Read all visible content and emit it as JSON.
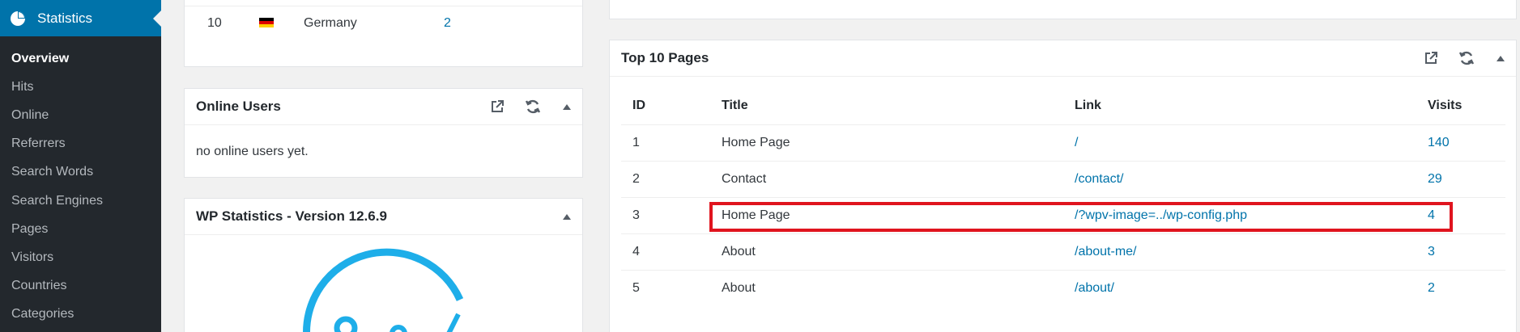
{
  "sidebar": {
    "header_title": "Statistics",
    "header_icon": "pie-chart-icon",
    "items": [
      {
        "label": "Overview",
        "current": true
      },
      {
        "label": "Hits"
      },
      {
        "label": "Online"
      },
      {
        "label": "Referrers"
      },
      {
        "label": "Search Words"
      },
      {
        "label": "Search Engines"
      },
      {
        "label": "Pages"
      },
      {
        "label": "Visitors"
      },
      {
        "label": "Countries"
      },
      {
        "label": "Categories"
      }
    ]
  },
  "countries": {
    "row": {
      "rank": "10",
      "flag_icon": "germany-flag-icon",
      "name": "Germany",
      "count": "2"
    }
  },
  "online_users": {
    "title": "Online Users",
    "empty_text": "no online users yet."
  },
  "version_panel": {
    "title": "WP Statistics - Version 12.6.9",
    "logo_color": "#1eaee9"
  },
  "top_pages": {
    "title": "Top 10 Pages",
    "columns": [
      "ID",
      "Title",
      "Link",
      "Visits"
    ],
    "rows": [
      {
        "id": "1",
        "title": "Home Page",
        "link": "/",
        "visits": "140"
      },
      {
        "id": "2",
        "title": "Contact",
        "link": "/contact/",
        "visits": "29"
      },
      {
        "id": "3",
        "title": "Home Page",
        "link": "/?wpv-image=../wp-config.php",
        "visits": "4"
      },
      {
        "id": "4",
        "title": "About",
        "link": "/about-me/",
        "visits": "3"
      },
      {
        "id": "5",
        "title": "About",
        "link": "/about/",
        "visits": "2"
      }
    ]
  },
  "colors": {
    "accent": "#0073aa",
    "sidebar_bg": "#23282d",
    "highlight": "#e0141e"
  }
}
